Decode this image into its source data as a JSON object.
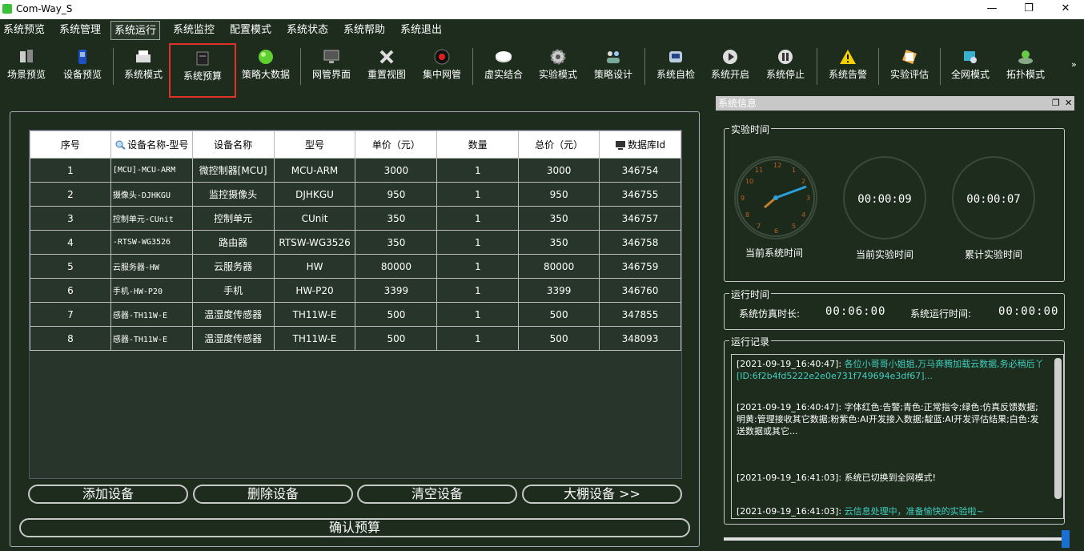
{
  "window": {
    "title": "Com-Way_S",
    "min": "—",
    "max": "❐",
    "close": "✕"
  },
  "menu": [
    "系统预览",
    "系统管理",
    "系统运行",
    "系统监控",
    "配置模式",
    "系统状态",
    "系统帮助",
    "系统退出"
  ],
  "toolbar": [
    {
      "label": "场景预览",
      "icon": "scene-icon"
    },
    {
      "label": "设备预览",
      "icon": "device-icon"
    },
    {
      "label": "系统模式",
      "icon": "printer-icon"
    },
    {
      "label": "系统预算",
      "icon": "book-icon"
    },
    {
      "label": "策略大数据",
      "icon": "globe-icon"
    },
    {
      "label": "网管界面",
      "icon": "monitor-icon"
    },
    {
      "label": "重置视图",
      "icon": "reset-icon"
    },
    {
      "label": "集中网管",
      "icon": "record-icon"
    },
    {
      "label": "虚实结合",
      "icon": "disc-icon"
    },
    {
      "label": "实验模式",
      "icon": "gear-icon"
    },
    {
      "label": "策略设计",
      "icon": "users-icon"
    },
    {
      "label": "系统自检",
      "icon": "check-icon"
    },
    {
      "label": "系统开启",
      "icon": "play-icon"
    },
    {
      "label": "系统停止",
      "icon": "pause-icon"
    },
    {
      "label": "系统告警",
      "icon": "warning-icon"
    },
    {
      "label": "实验评估",
      "icon": "assess-icon"
    },
    {
      "label": "全网模式",
      "icon": "network-icon"
    },
    {
      "label": "拓扑模式",
      "icon": "topology-icon"
    }
  ],
  "toolbar_more": "»",
  "table": {
    "headers": [
      "序号",
      "设备名称-型号",
      "设备名称",
      "型号",
      "单价（元）",
      "数量",
      "总价（元）",
      "数据库Id"
    ],
    "rows": [
      [
        "1",
        "[MCU]-MCU-ARM",
        "微控制器[MCU]",
        "MCU-ARM",
        "3000",
        "1",
        "3000",
        "346754"
      ],
      [
        "2",
        "摄像头-DJHKGU",
        "监控摄像头",
        "DJHKGU",
        "950",
        "1",
        "950",
        "346755"
      ],
      [
        "3",
        "控制单元-CUnit",
        "控制单元",
        "CUnit",
        "350",
        "1",
        "350",
        "346757"
      ],
      [
        "4",
        "-RTSW-WG3526",
        "路由器",
        "RTSW-WG3526",
        "350",
        "1",
        "350",
        "346758"
      ],
      [
        "5",
        "云服务器-HW",
        "云服务器",
        "HW",
        "80000",
        "1",
        "80000",
        "346759"
      ],
      [
        "6",
        "手机-HW-P20",
        "手机",
        "HW-P20",
        "3399",
        "1",
        "3399",
        "346760"
      ],
      [
        "7",
        "感器-TH11W-E",
        "温湿度传感器",
        "TH11W-E",
        "500",
        "1",
        "500",
        "347855"
      ],
      [
        "8",
        "感器-TH11W-E",
        "温湿度传感器",
        "TH11W-E",
        "500",
        "1",
        "500",
        "348093"
      ]
    ]
  },
  "buttons": {
    "add": "添加设备",
    "delete": "删除设备",
    "clear": "清空设备",
    "greenhouse": "大棚设备 >>",
    "confirm": "确认预算"
  },
  "sysinfo": {
    "title": "系统信息",
    "exp_time_title": "实验时间",
    "clock1_label": "当前系统时间",
    "clock2_label": "当前实验时间",
    "clock2_value": "00:00:09",
    "clock3_label": "累计实验时间",
    "clock3_value": "00:00:07",
    "run_time_title": "运行时间",
    "sim_label": "系统仿真时长:",
    "sim_value": "00:06:00",
    "run_label": "系统运行时间:",
    "run_value": "00:00:00",
    "log_title": "运行记录",
    "logs": [
      {
        "time": "[2021-09-19_16:40:47]: ",
        "text": "各位小哥哥小姐姐,万马奔腾加载云数据,务必稍后丫[ID:6f2b4fd5222e2e0e731f749694e3df67]...",
        "hl": true
      },
      {
        "time": "[2021-09-19_16:40:47]: ",
        "text": "字体红色:告警;青色:正常指令;绿色:仿真反馈数据;明黄:管理接收其它数据;粉紫色:AI开发接入数据;靛蓝:AI开发评估结果;白色:发送数据或其它...",
        "hl": false
      },
      {
        "time": "[2021-09-19_16:41:03]: ",
        "text": "系统已切换到全网模式!",
        "hl": false
      },
      {
        "time": "[2021-09-19_16:41:03]: ",
        "text": "云信息处理中，准备愉快的实验啦~",
        "hl": true
      }
    ]
  },
  "slider_value": 1.0
}
